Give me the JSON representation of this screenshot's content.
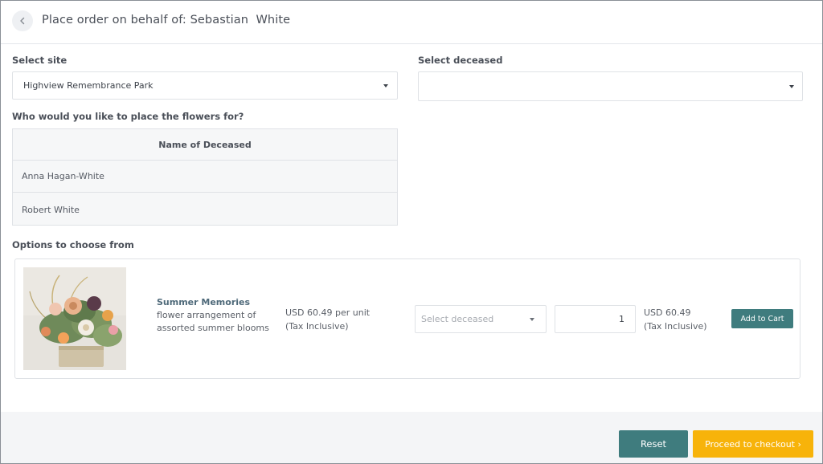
{
  "header": {
    "title": "Place order on behalf of: Sebastian  White"
  },
  "site": {
    "label": "Select site",
    "selected": "Highview Remembrance Park"
  },
  "deceased_select": {
    "label": "Select deceased",
    "selected": ""
  },
  "deceased_table": {
    "prompt": "Who would you like to place the flowers for?",
    "column_header": "Name of Deceased",
    "rows": [
      "Anna Hagan-White",
      "Robert White"
    ]
  },
  "options": {
    "label": "Options to choose from",
    "product": {
      "name": "Summer Memories",
      "description": "flower arrangement of assorted summer blooms",
      "unit_price": "USD 60.49 per unit",
      "unit_tax_note": "(Tax Inclusive)",
      "deceased_placeholder": "Select deceased",
      "quantity": "1",
      "line_total": "USD 60.49",
      "line_tax_note": "(Tax Inclusive)",
      "add_to_cart_label": "Add to Cart"
    }
  },
  "footer": {
    "reset_label": "Reset",
    "checkout_label": "Proceed to checkout ›"
  },
  "colors": {
    "teal": "#3f7c7e",
    "amber": "#f7b30a",
    "footer_bg": "#f4f5f7"
  },
  "icons": {
    "back": "chevron-left-icon",
    "dropdown": "caret-down-icon"
  }
}
